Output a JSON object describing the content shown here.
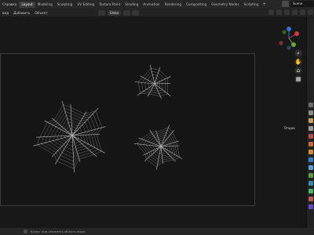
{
  "menu": {
    "items": [
      "Справка"
    ]
  },
  "workspaces": {
    "tabs": [
      "Layout",
      "Modeling",
      "Sculpting",
      "UV Editing",
      "Texture Paint",
      "Shading",
      "Animation",
      "Rendering",
      "Compositing",
      "Geometry Nodes",
      "Scripting"
    ],
    "active": "Layout"
  },
  "scene": {
    "name": "Scene"
  },
  "viewport_header": {
    "items": [
      "вид",
      "Добавить",
      "Объект"
    ],
    "transform_orientation": "Globa"
  },
  "viewport": {
    "options_label": "Опции"
  },
  "gizmo": {
    "colors": {
      "x": "#d23a4c",
      "y": "#6ea53a",
      "z": "#3a72d2",
      "neg": "#5a5a5a"
    }
  },
  "nav_buttons": [
    "zoom-icon",
    "pan-hand-icon",
    "camera-icon",
    "grid-icon"
  ],
  "status": {
    "text": "Вокруг вид (изменить область вида)"
  }
}
